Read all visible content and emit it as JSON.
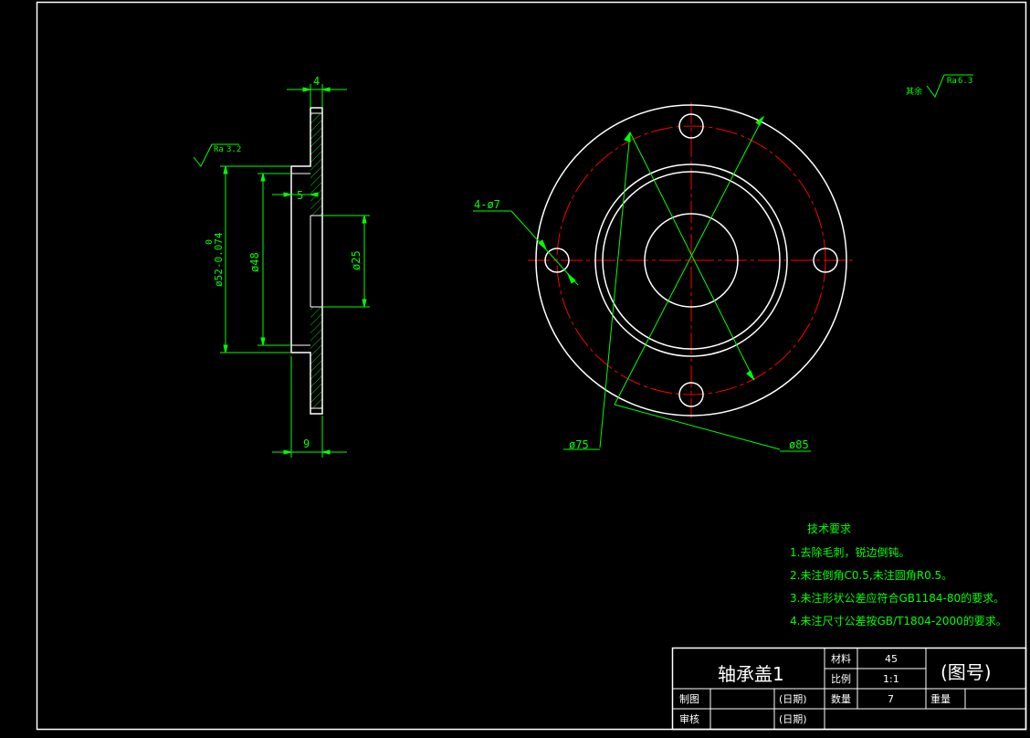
{
  "surface": {
    "label": "Ra",
    "value_side": "3.2",
    "value_general": "6.3",
    "general_prefix": "其余"
  },
  "dimensions": {
    "width_top": "4",
    "width_bottom": "9",
    "step": "5",
    "dia_52_main": "ø52-0.074",
    "dia_52_upper": "0",
    "dia_48": "ø48",
    "dia_25": "ø25",
    "holes": "4-ø7",
    "dia_75": "ø75",
    "dia_85": "ø85"
  },
  "requirements": {
    "heading": "技术要求",
    "items": [
      "1.去除毛刺，锐边倒钝。",
      "2.未注倒角C0.5,未注圆角R0.5。",
      "3.未注形状公差应符合GB1184-80的要求。",
      "4.未注尺寸公差按GB/T1804-2000的要求。"
    ]
  },
  "title_block": {
    "part_name": "轴承盖1",
    "material_label": "材料",
    "material_value": "45",
    "scale_label": "比例",
    "scale_value": "1:1",
    "quantity_label": "数量",
    "quantity_value": "7",
    "weight_label": "重量",
    "drawing_no": "(图号)",
    "drawn_by": "制图",
    "checked_by": "审核",
    "date1": "(日期)",
    "date2": "(日期)"
  },
  "colors": {
    "outline": "#ffffff",
    "dimension": "#00ff00",
    "centerline": "#ff0000",
    "background": "#000000"
  }
}
